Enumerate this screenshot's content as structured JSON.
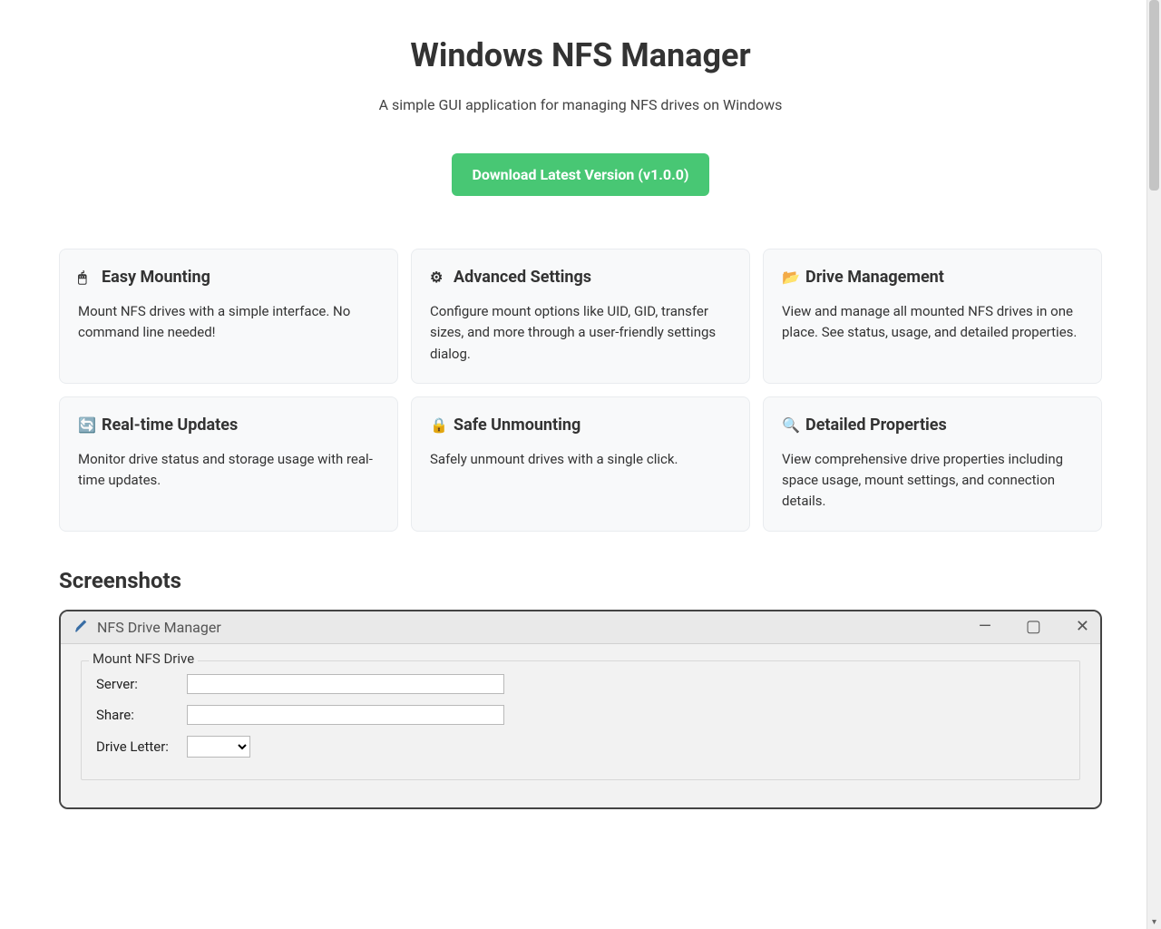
{
  "hero": {
    "title": "Windows NFS Manager",
    "subtitle": "A simple GUI application for managing NFS drives on Windows",
    "download_label": "Download Latest Version (v1.0.0)"
  },
  "features": [
    {
      "icon": "🖱",
      "title": "Easy Mounting",
      "desc": "Mount NFS drives with a simple interface. No command line needed!"
    },
    {
      "icon": "⚙",
      "title": "Advanced Settings",
      "desc": "Configure mount options like UID, GID, transfer sizes, and more through a user-friendly settings dialog."
    },
    {
      "icon": "📂",
      "title": "Drive Management",
      "desc": "View and manage all mounted NFS drives in one place. See status, usage, and detailed properties."
    },
    {
      "icon": "🔄",
      "title": "Real-time Updates",
      "desc": "Monitor drive status and storage usage with real-time updates."
    },
    {
      "icon": "🔒",
      "title": "Safe Unmounting",
      "desc": "Safely unmount drives with a single click."
    },
    {
      "icon": "🔍",
      "title": "Detailed Properties",
      "desc": "View comprehensive drive properties including space usage, mount settings, and connection details."
    }
  ],
  "sections": {
    "screenshots": "Screenshots"
  },
  "screenshot": {
    "window_title": "NFS Drive Manager",
    "group_label": "Mount NFS Drive",
    "fields": {
      "server": "Server:",
      "share": "Share:",
      "drive_letter": "Drive Letter:"
    }
  }
}
